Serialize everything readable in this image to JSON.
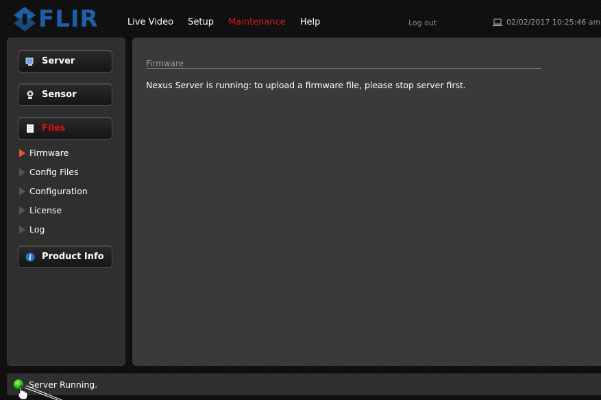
{
  "header": {
    "logo_text": "FLIR",
    "nav": [
      "Live Video",
      "Setup",
      "Maintenance",
      "Help"
    ],
    "active_nav": "Maintenance",
    "logout_label": "Log out",
    "datetime": "02/02/2017 10:25:46 am"
  },
  "sidebar": {
    "buttons": [
      {
        "label": "Server",
        "icon": "monitor-icon"
      },
      {
        "label": "Sensor",
        "icon": "camera-icon"
      },
      {
        "label": "Files",
        "icon": "document-icon",
        "active": true
      },
      {
        "label": "Product Info",
        "icon": "info-icon"
      }
    ],
    "file_items": [
      "Firmware",
      "Config Files",
      "Configuration",
      "License",
      "Log"
    ],
    "active_item": "Firmware"
  },
  "main": {
    "section_title": "Firmware",
    "message": "Nexus Server is running: to upload a firmware file, please stop server first."
  },
  "status": {
    "text": "Server Running.",
    "led_color": "#16b300"
  },
  "colors": {
    "accent_red": "#d01818",
    "brand_blue": "#1f5fa8"
  }
}
